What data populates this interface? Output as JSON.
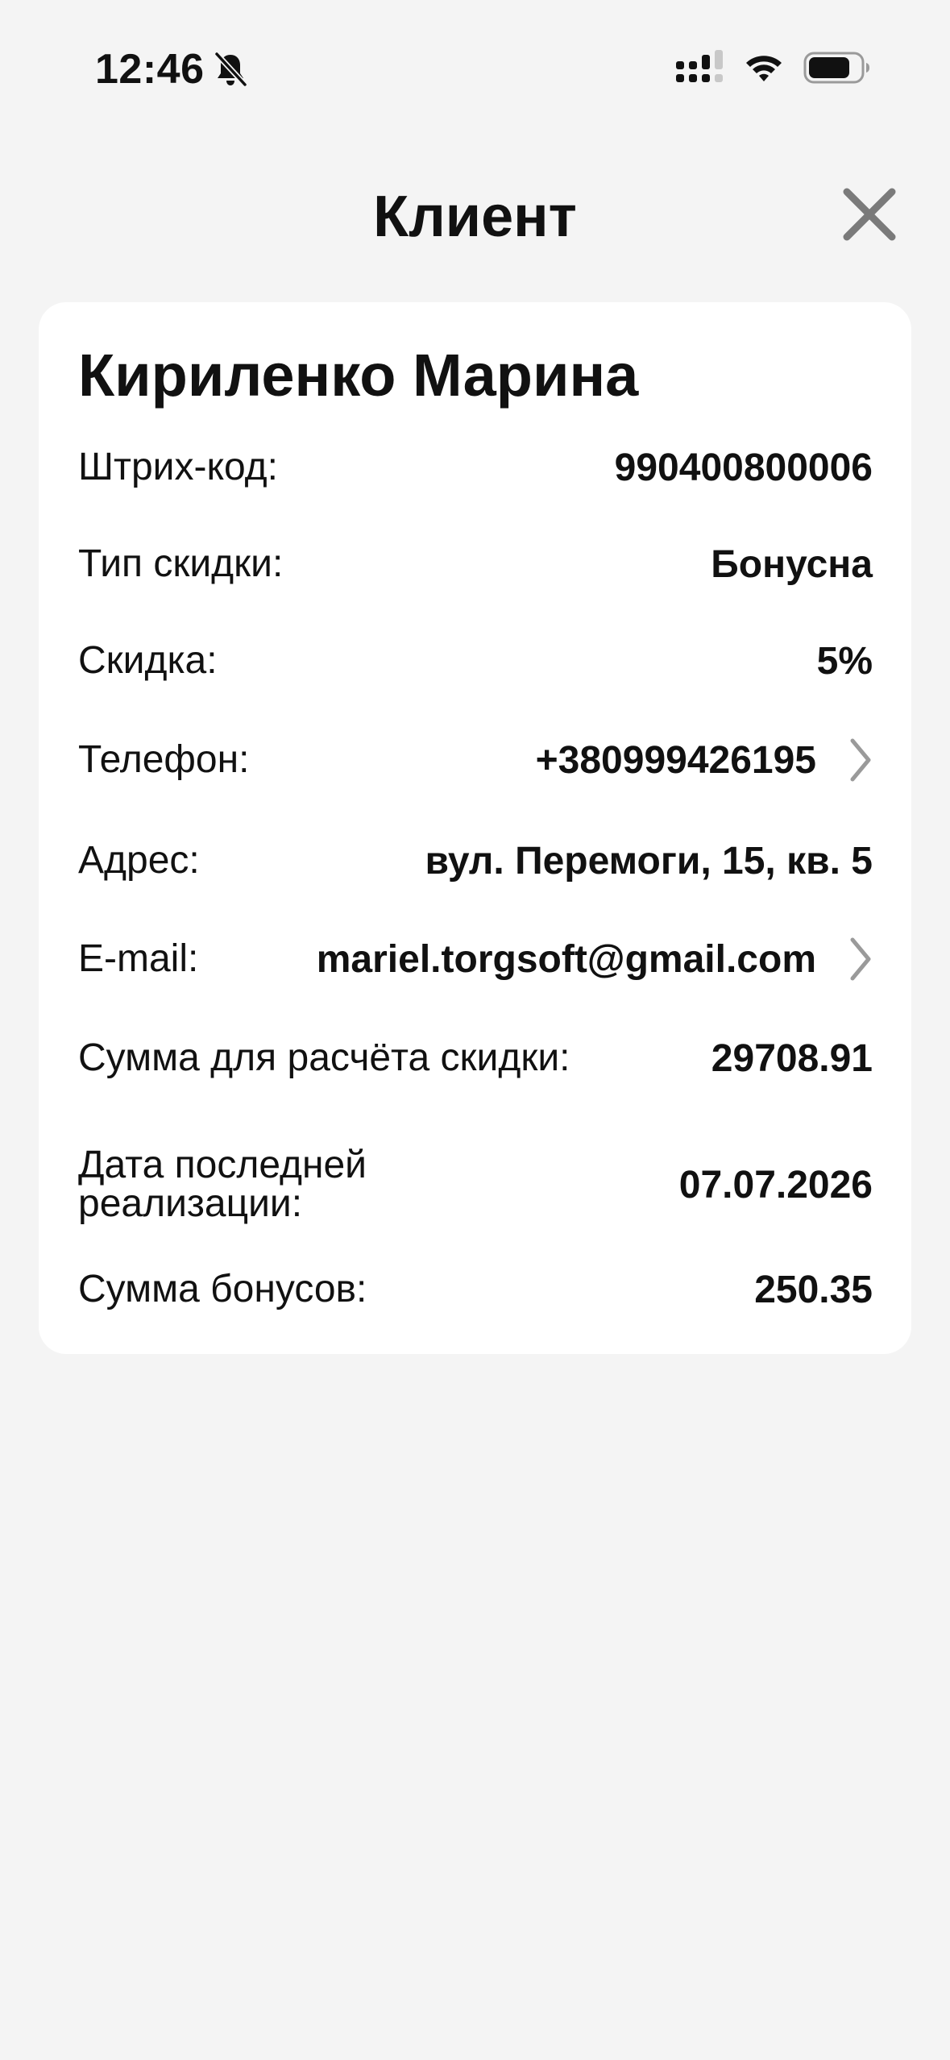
{
  "status_bar": {
    "time": "12:46",
    "icons": [
      "bell-off-icon",
      "cellular-signal-icon",
      "wifi-icon",
      "battery-icon"
    ]
  },
  "header": {
    "title": "Клиент",
    "close_icon": "close-icon"
  },
  "client": {
    "name": "Кириленко Марина",
    "fields": {
      "barcode": {
        "label": "Штрих-код:",
        "value": "990400800006"
      },
      "discount_type": {
        "label": "Тип скидки:",
        "value": "Бонусна"
      },
      "discount": {
        "label": "Скидка:",
        "value": "5%"
      },
      "phone": {
        "label": "Телефон:",
        "value": "+380999426195"
      },
      "address": {
        "label": "Адрес:",
        "value": "вул. Перемоги, 15, кв. 5"
      },
      "email": {
        "label": "E-mail:",
        "value": "mariel.torgsoft@gmail.com"
      },
      "discount_sum": {
        "label": "Сумма для расчёта скидки:",
        "value": "29708.91"
      },
      "last_sale_date": {
        "label_line1": "Дата последней",
        "label_line2": "реализации:",
        "value": "07.07.2026"
      },
      "bonus_sum": {
        "label": "Сумма бонусов:",
        "value": "250.35"
      }
    }
  },
  "colors": {
    "background": "#f4f4f4",
    "card": "#ffffff",
    "text": "#111111",
    "icon_gray": "#7a7a7a",
    "chevron_gray": "#9a9a9a"
  }
}
